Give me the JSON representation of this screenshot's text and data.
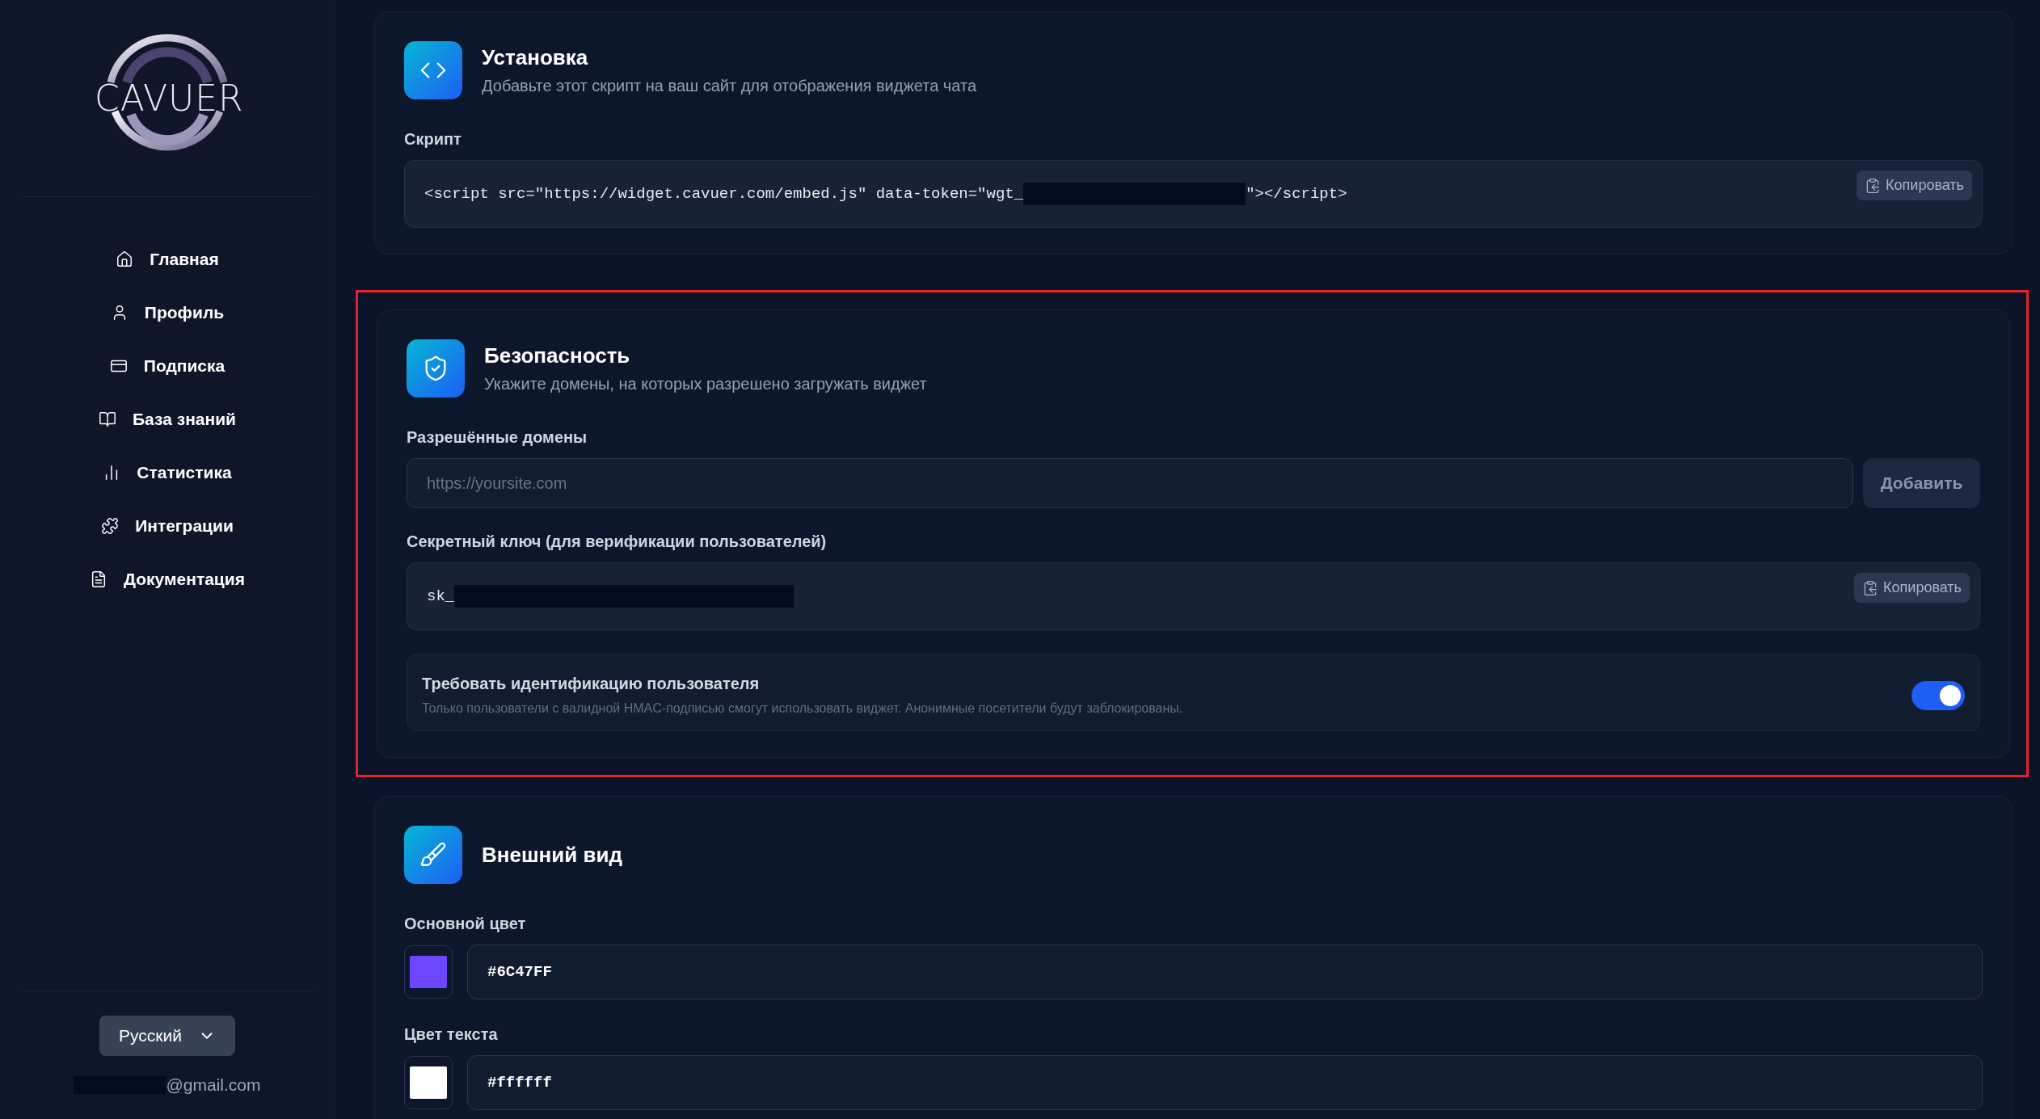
{
  "sidebar": {
    "logo_text": "CAVUER",
    "nav": [
      {
        "label": "Главная"
      },
      {
        "label": "Профиль"
      },
      {
        "label": "Подписка"
      },
      {
        "label": "База знаний"
      },
      {
        "label": "Статистика"
      },
      {
        "label": "Интеграции"
      },
      {
        "label": "Документация"
      }
    ],
    "language": "Русский",
    "email_suffix": "@gmail.com"
  },
  "installation": {
    "title": "Установка",
    "subtitle": "Добавьте этот скрипт на ваш сайт для отображения виджета чата",
    "script_label": "Скрипт",
    "script_before": "<script src=\"https://widget.cavuer.com/embed.js\" data-token=\"wgt_",
    "script_after": "\"></script>",
    "copy_label": "Копировать"
  },
  "security": {
    "highlighted": true,
    "title": "Безопасность",
    "subtitle": "Укажите домены, на которых разрешено загружать виджет",
    "domains_label": "Разрешённые домены",
    "domain_placeholder": "https://yoursite.com",
    "add_label": "Добавить",
    "secret_label": "Секретный ключ (для верификации пользователей)",
    "secret_prefix": "sk_",
    "copy_label": "Копировать",
    "require": {
      "title": "Требовать идентификацию пользователя",
      "description": "Только пользователи с валидной HMAC-подписью смогут использовать виджет. Анонимные посетители будут заблокированы.",
      "on": true
    }
  },
  "appearance": {
    "title": "Внешний вид",
    "colors": [
      {
        "label": "Основной цвет",
        "value": "#6C47FF",
        "color": "#6c47ff"
      },
      {
        "label": "Цвет текста",
        "value": "#ffffff",
        "color": "#ffffff"
      }
    ]
  }
}
